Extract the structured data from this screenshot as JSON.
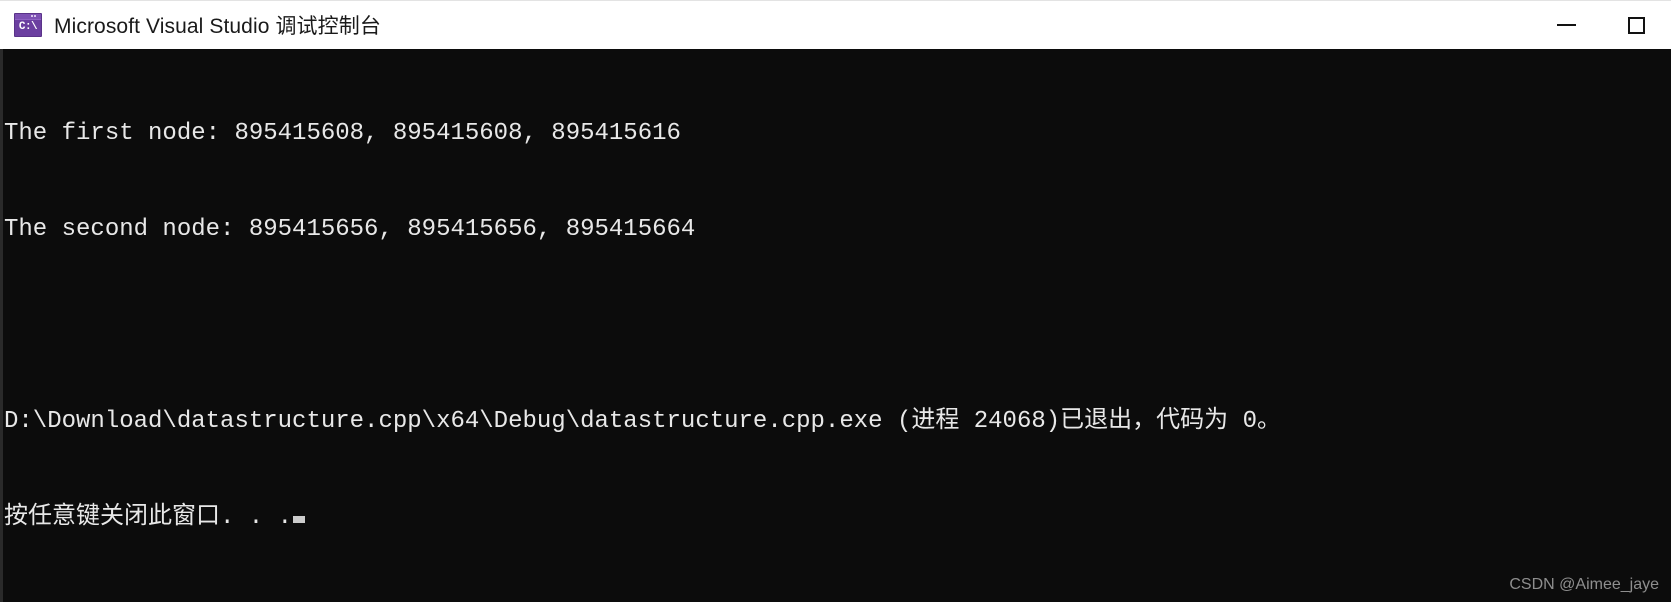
{
  "window": {
    "title": "Microsoft Visual Studio 调试控制台",
    "icon_name": "console-app-icon",
    "icon_glyph": "C:\\",
    "controls": {
      "minimize_label": "最小化",
      "maximize_label": "最大化"
    },
    "colors": {
      "titlebar_background": "#ffffff",
      "title_text": "#1a1a1a",
      "console_background": "#0c0c0c",
      "console_text": "#e8e8e8",
      "icon_accent": "#6b3fa0",
      "cursor": "#cccccc",
      "watermark_text": "#8e8e8e"
    }
  },
  "console": {
    "lines": [
      "The first node: 895415608, 895415608, 895415616",
      "The second node: 895415656, 895415656, 895415664",
      "",
      "D:\\Download\\datastructure.cpp\\x64\\Debug\\datastructure.cpp.exe (进程 24068)已退出，代码为 0。",
      "按任意键关闭此窗口. . ."
    ],
    "cursor_visible": true
  },
  "watermark": {
    "text": "CSDN @Aimee_jaye"
  }
}
